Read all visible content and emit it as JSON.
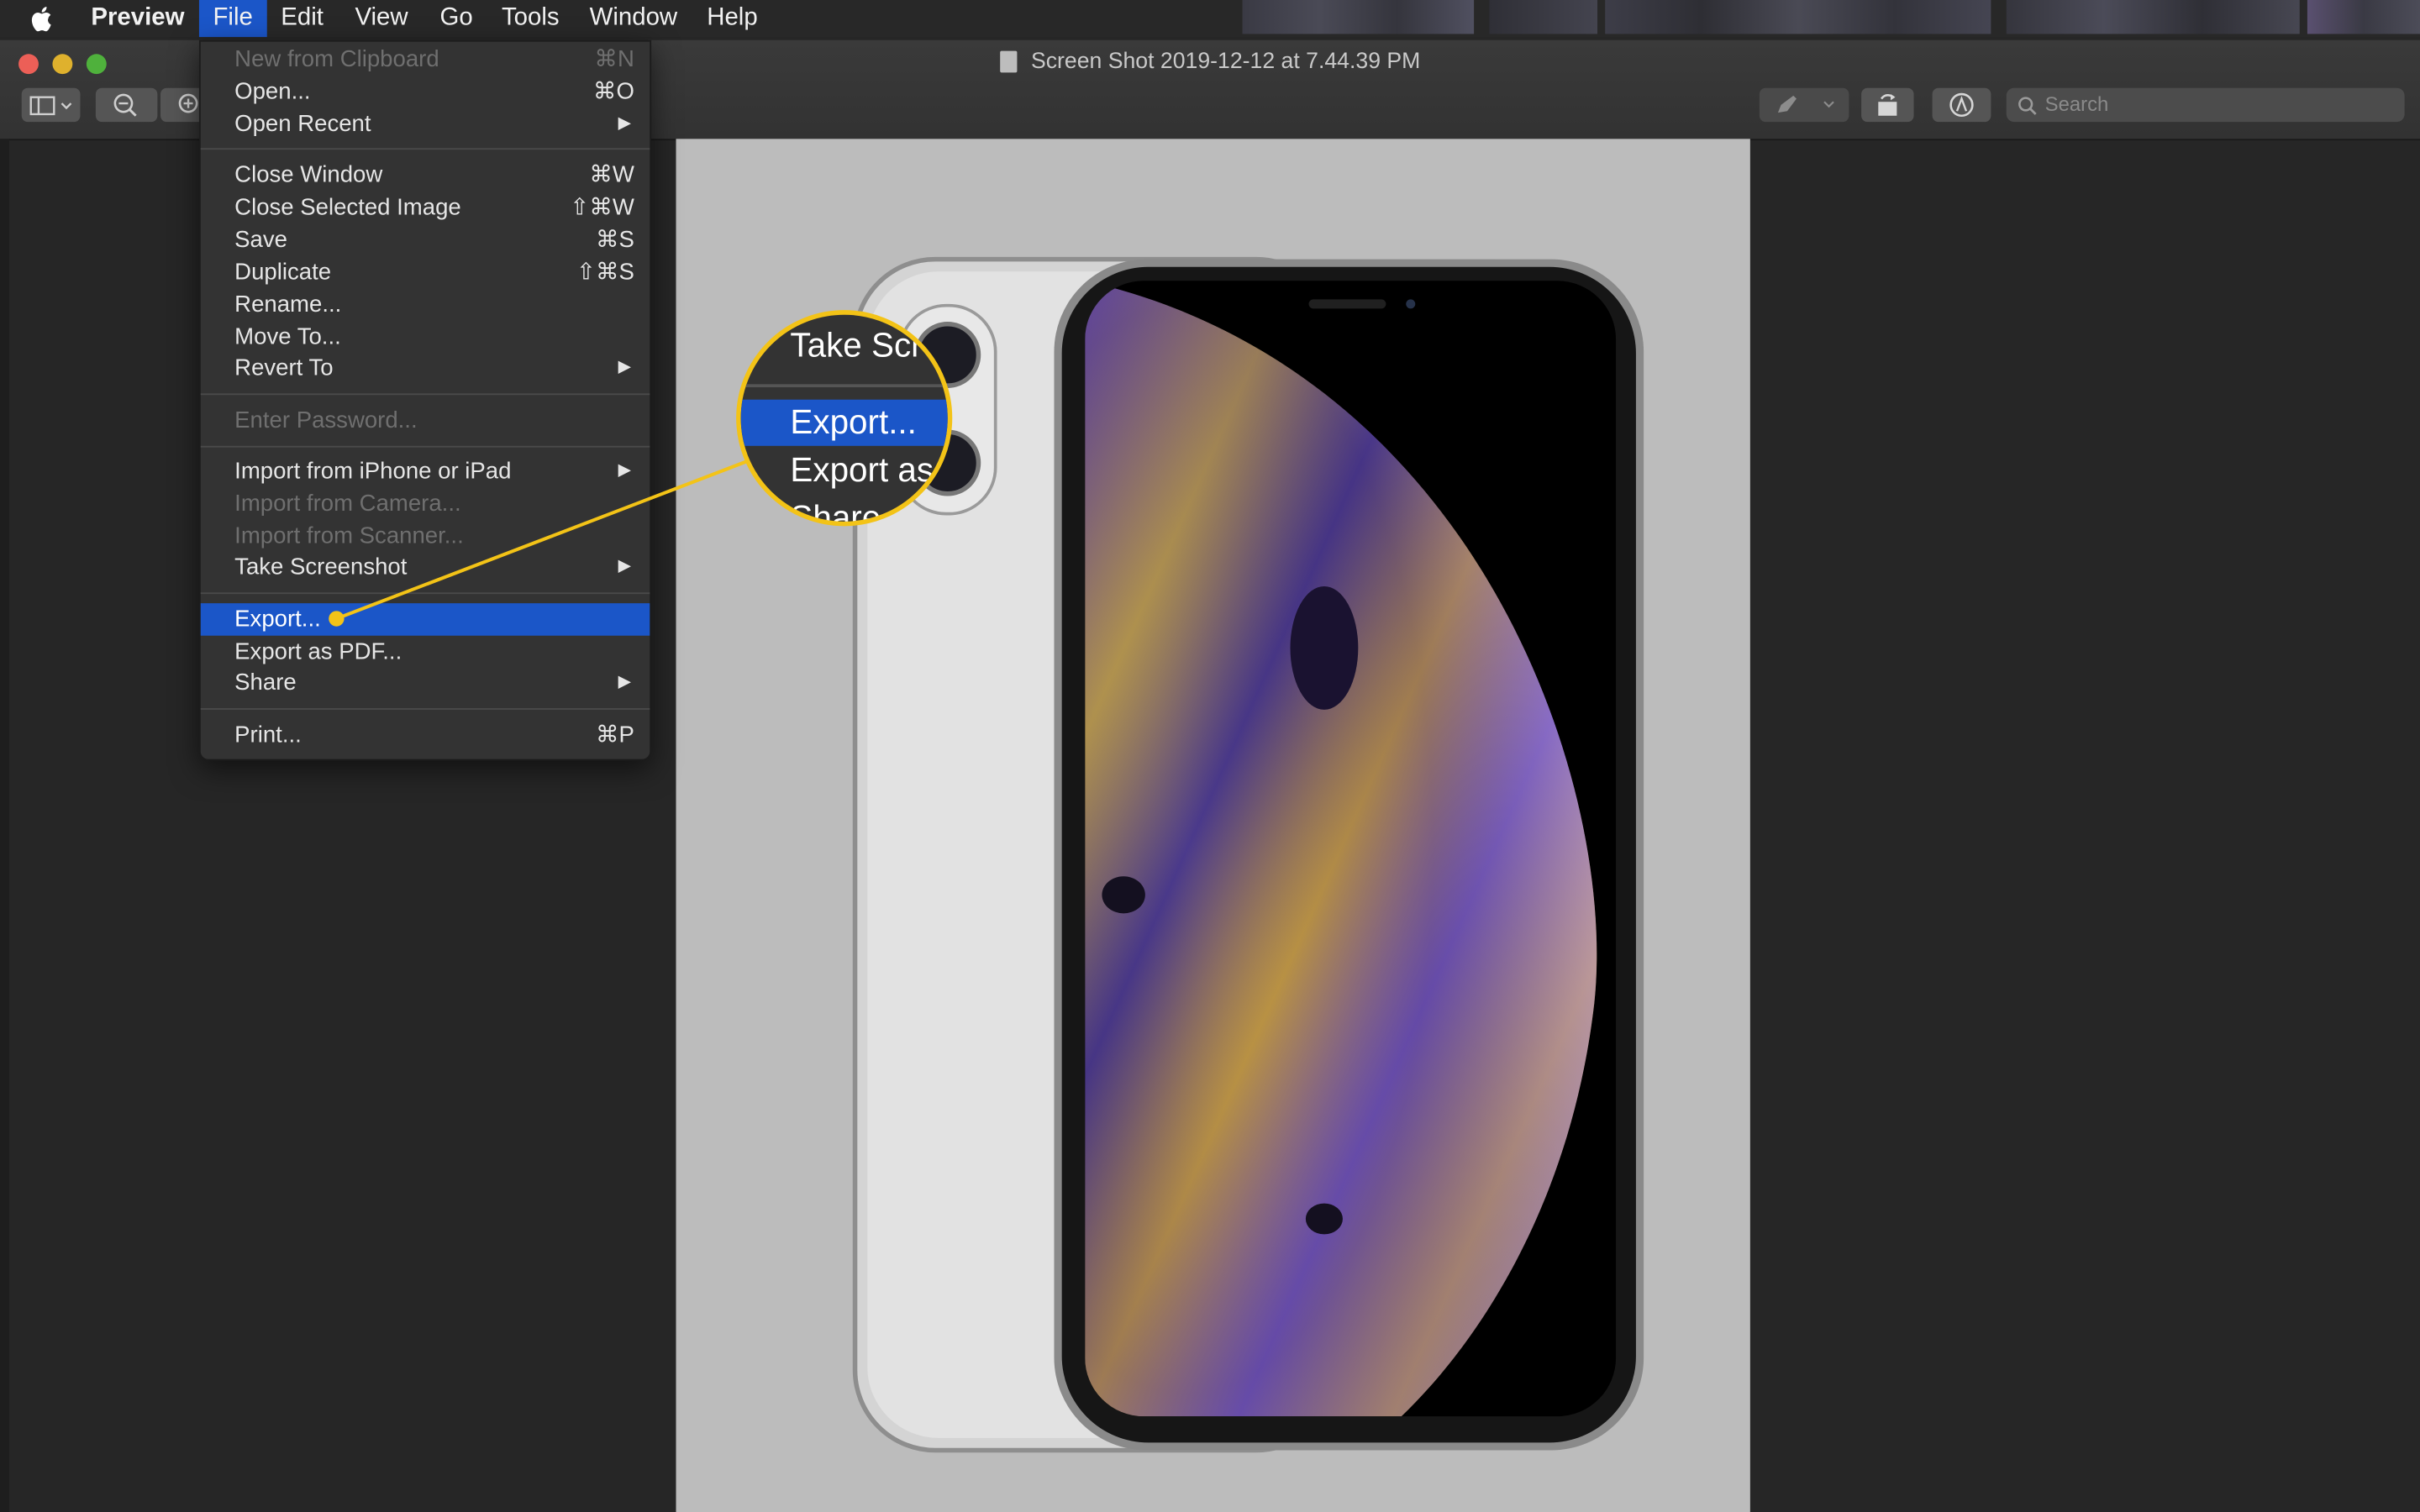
{
  "menubar": {
    "app_name": "Preview",
    "items": [
      "File",
      "Edit",
      "View",
      "Go",
      "Tools",
      "Window",
      "Help"
    ],
    "active_item": "File"
  },
  "window": {
    "title": "Screen Shot 2019-12-12 at 7.44.39 PM",
    "search_placeholder": "Search"
  },
  "file_menu": {
    "items": [
      {
        "label": "New from Clipboard",
        "shortcut": "⌘N",
        "disabled": true
      },
      {
        "label": "Open...",
        "shortcut": "⌘O"
      },
      {
        "label": "Open Recent",
        "submenu": true
      },
      {
        "label": "Close Window",
        "shortcut": "⌘W"
      },
      {
        "label": "Close Selected Image",
        "shortcut": "⇧⌘W"
      },
      {
        "label": "Save",
        "shortcut": "⌘S"
      },
      {
        "label": "Duplicate",
        "shortcut": "⇧⌘S"
      },
      {
        "label": "Rename..."
      },
      {
        "label": "Move To..."
      },
      {
        "label": "Revert To",
        "submenu": true
      },
      {
        "label": "Enter Password...",
        "disabled": true
      },
      {
        "label": "Import from iPhone or iPad",
        "submenu": true
      },
      {
        "label": "Import from Camera...",
        "disabled": true
      },
      {
        "label": "Import from Scanner...",
        "disabled": true
      },
      {
        "label": "Take Screenshot",
        "submenu": true
      },
      {
        "label": "Export...",
        "highlighted": true
      },
      {
        "label": "Export as PDF..."
      },
      {
        "label": "Share",
        "submenu": true
      },
      {
        "label": "Print...",
        "shortcut": "⌘P"
      }
    ]
  },
  "callout": {
    "lines": [
      "Take Scr",
      "Export...",
      "Export as",
      "Share"
    ],
    "color": "#f3c317"
  },
  "colors": {
    "highlight": "#1b56c8",
    "menu_bg": "#333333",
    "canvas": "#bcbcbc"
  }
}
